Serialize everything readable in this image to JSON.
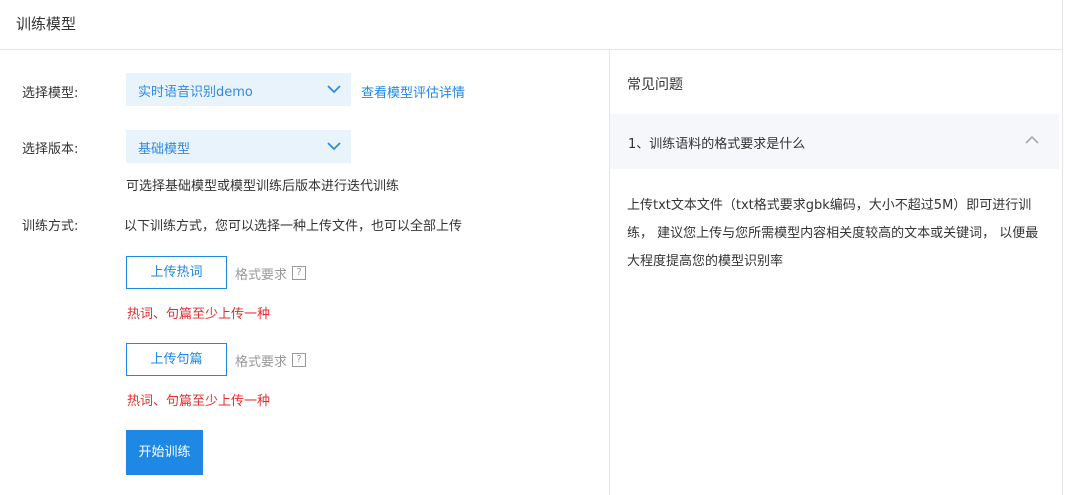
{
  "header": {
    "title": "训练模型"
  },
  "form": {
    "model_label": "选择模型:",
    "model_value": "实时语音识别demo",
    "model_link": "查看模型评估详情",
    "version_label": "选择版本:",
    "version_value": "基础模型",
    "version_hint": "可选择基础模型或模型训练后版本进行迭代训练",
    "method_label": "训练方式:",
    "method_desc": "以下训练方式，您可以选择一种上传文件，也可以全部上传",
    "upload_hotwords": "上传热词",
    "upload_sentences": "上传句篇",
    "format_req": "格式要求",
    "help_glyph": "?",
    "warning": "热词、句篇至少上传一种",
    "start_button": "开始训练"
  },
  "faq": {
    "title": "常见问题",
    "item_question": "1、训练语料的格式要求是什么",
    "item_answer": "上传txt文本文件（txt格式要求gbk编码，大小不超过5M）即可进行训练，  建议您上传与您所需模型内容相关度较高的文本或关键词， 以便最大程度提高您的模型识别率"
  },
  "icons": {
    "chevron": "chevron-down-icon",
    "collapse": "chevron-up-icon",
    "help": "question-icon"
  },
  "colors": {
    "accent": "#1e88e5",
    "select_bg": "#e9f3fc",
    "warning": "#e0302b",
    "faq_bg": "#f5f7fa"
  }
}
